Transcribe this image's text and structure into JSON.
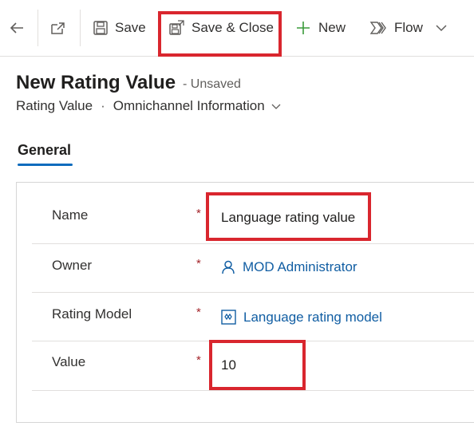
{
  "toolbar": {
    "save_label": "Save",
    "save_close_label": "Save & Close",
    "new_label": "New",
    "flow_label": "Flow"
  },
  "header": {
    "title": "New Rating Value",
    "status": "- Unsaved",
    "entity": "Rating Value",
    "form_name": "Omnichannel Information"
  },
  "tabs": [
    {
      "label": "General",
      "selected": true
    }
  ],
  "fields": {
    "name": {
      "label": "Name",
      "required": "*",
      "value": "Language rating value"
    },
    "owner": {
      "label": "Owner",
      "required": "*",
      "value": "MOD Administrator"
    },
    "rating_model": {
      "label": "Rating Model",
      "required": "*",
      "value": "Language rating model"
    },
    "value": {
      "label": "Value",
      "required": "*",
      "value": "10"
    }
  },
  "colors": {
    "accent": "#0f6cbd",
    "highlight": "#d9262e",
    "link": "#115ea3",
    "required": "#a4262c"
  },
  "icons": [
    "back-arrow-icon",
    "open-in-new-window-icon",
    "save-icon",
    "save-close-icon",
    "plus-icon",
    "flow-icon",
    "chevron-down-icon",
    "person-icon",
    "entity-icon"
  ]
}
